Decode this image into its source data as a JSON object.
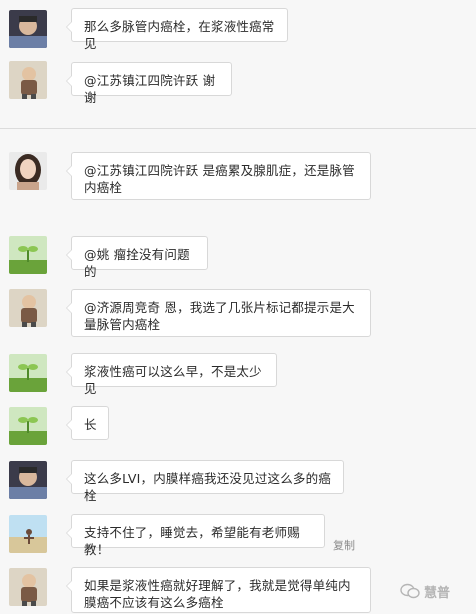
{
  "messages": [
    {
      "avatar": "grey-avatar",
      "text": "那么多脉管内癌栓，在浆液性癌常见"
    },
    {
      "avatar": "toddler-avatar",
      "text": "@江苏镇江四院许跃 谢谢"
    },
    {
      "avatar": "woman-avatar",
      "text": "@江苏镇江四院许跃 是癌累及腺肌症，还是脉管内癌栓"
    },
    {
      "avatar": "sprout-avatar",
      "text": "@姚 瘤拴没有问题的"
    },
    {
      "avatar": "toddler-avatar",
      "text": "@济源周竞奇 恩，我选了几张片标记都提示是大量脉管内癌栓"
    },
    {
      "avatar": "sprout-avatar",
      "text": "浆液性癌可以这么早，不是太少见"
    },
    {
      "avatar": "sprout-avatar",
      "text": "长"
    },
    {
      "avatar": "grey-avatar",
      "text": "这么多LVI，内膜样癌我还没见过这么多的癌栓"
    },
    {
      "avatar": "beach-avatar",
      "text": "支持不住了，睡觉去，希望能有老师赐教！"
    },
    {
      "avatar": "toddler-avatar",
      "text": "如果是浆液性癌就好理解了，我就是觉得单纯内膜癌不应该有这么多癌栓"
    }
  ],
  "copy_label": "复制",
  "watermark": "慧普"
}
